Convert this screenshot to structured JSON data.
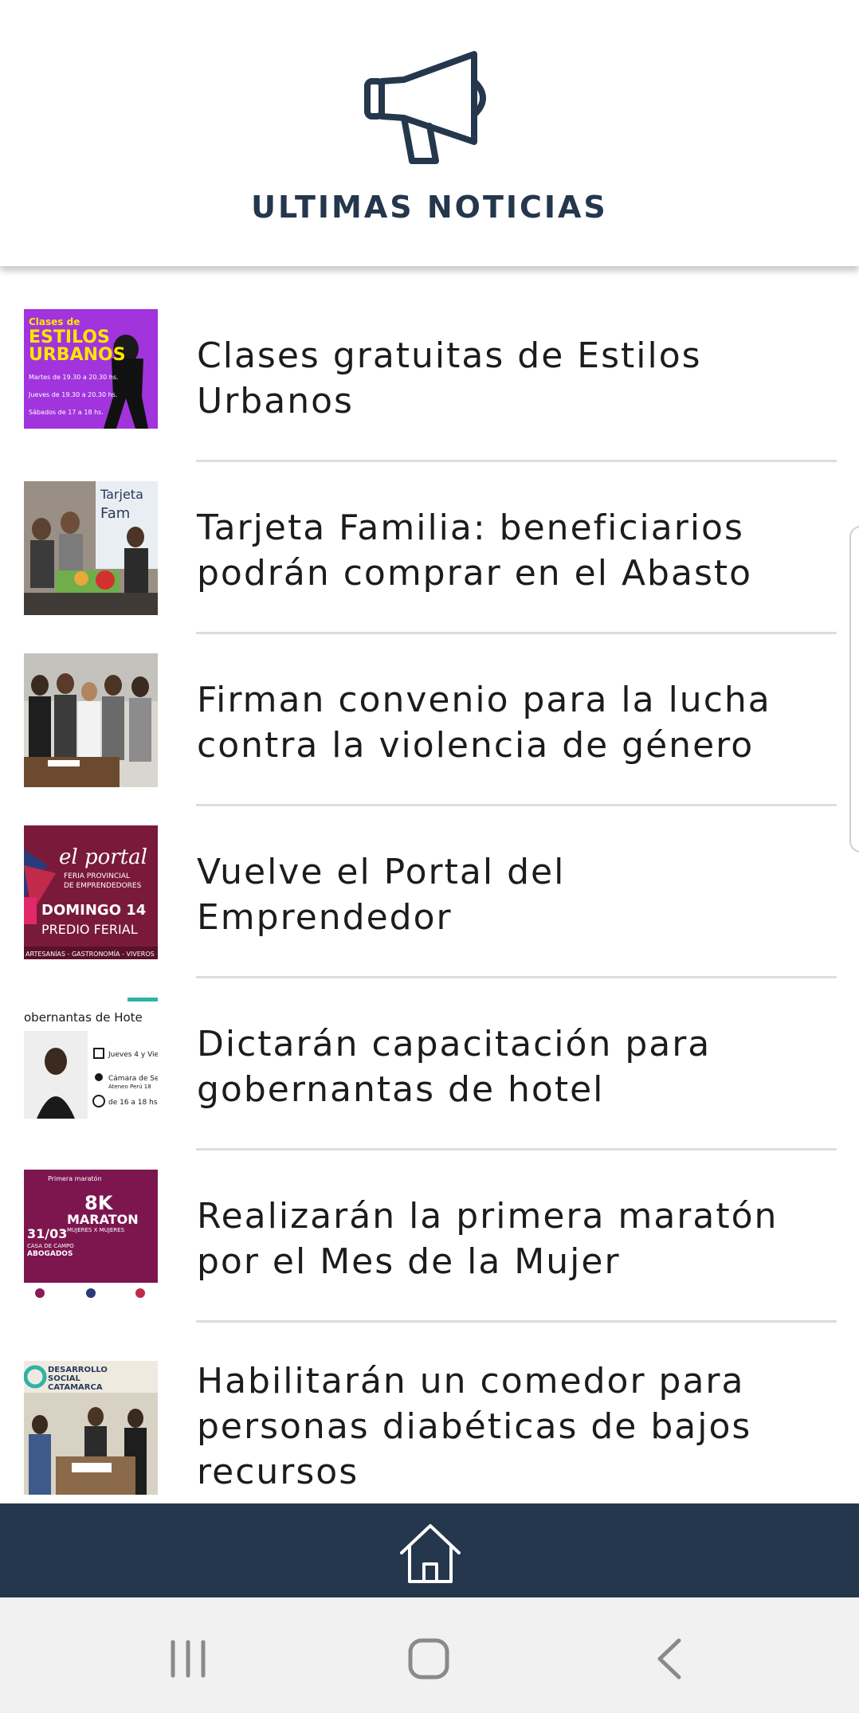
{
  "header": {
    "icon": "megaphone-icon",
    "title": "ULTIMAS NOTICIAS"
  },
  "colors": {
    "brand": "#24374c",
    "divider": "#dddddd",
    "nav_background": "#f1f1f1"
  },
  "news": [
    {
      "title": "Clases gratuitas de Estilos Urbanos",
      "thumbnail_text": [
        "Clases de",
        "ESTILOS",
        "URBANOS",
        "Martes de 19.30 a 20.30 hs.",
        "Jueves de 19.30 a 20.30 hs.",
        "Sábados de 17 a 18 hs."
      ]
    },
    {
      "title": "Tarjeta Familia: beneficiarios podrán comprar en el Abasto",
      "thumbnail_text": [
        "Tarjeta",
        "Fam"
      ]
    },
    {
      "title": "Firman convenio para la lucha contra la violencia de género",
      "thumbnail_text": []
    },
    {
      "title": "Vuelve el Portal del Emprendedor",
      "thumbnail_text": [
        "el portal",
        "FERIA PROVINCIAL",
        "DE EMPRENDEDORES",
        "DOMINGO 14",
        "PREDIO FERIAL",
        "ARTESANÍAS - GASTRONOMÍA - VIVEROS"
      ]
    },
    {
      "title": "Dictarán capacitación para gobernantas de hotel",
      "thumbnail_text": [
        "obernantas de Hote",
        "Jueves 4 y Vier",
        "Cámara de Ser",
        "Ateneo Perú 18",
        "de 16 a 18 hs"
      ]
    },
    {
      "title": "Realizarán la primera maratón por el Mes de la Mujer",
      "thumbnail_text": [
        "Primera maratón",
        "8K",
        "MARATON",
        "MUJERES X MUJERES",
        "31/03",
        "CASA DE CAMPO",
        "ABOGADOS"
      ]
    },
    {
      "title": "Habilitarán un comedor para personas diabéticas de bajos recursos",
      "thumbnail_text": [
        "DESARROLLO",
        "SOCIAL",
        "CATAMARCA"
      ]
    }
  ],
  "tabbar": {
    "home_icon": "home-icon"
  },
  "system_nav": {
    "recents_icon": "recents-icon",
    "home_icon": "system-home-icon",
    "back_icon": "back-icon"
  }
}
